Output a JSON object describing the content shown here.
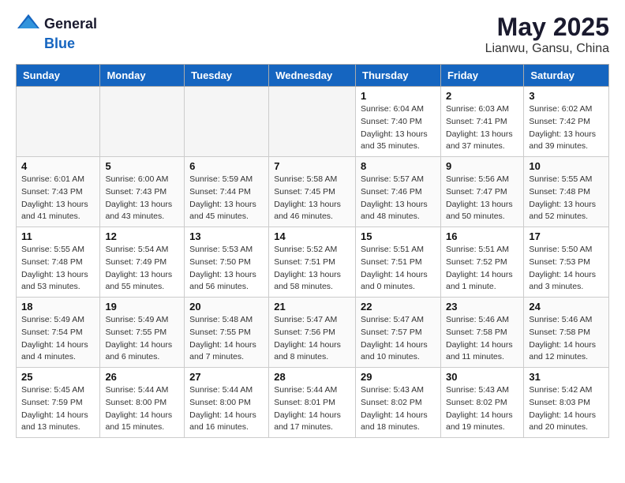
{
  "header": {
    "logo_general": "General",
    "logo_blue": "Blue",
    "title": "May 2025",
    "subtitle": "Lianwu, Gansu, China"
  },
  "days_of_week": [
    "Sunday",
    "Monday",
    "Tuesday",
    "Wednesday",
    "Thursday",
    "Friday",
    "Saturday"
  ],
  "weeks": [
    [
      {
        "day": "",
        "empty": true
      },
      {
        "day": "",
        "empty": true
      },
      {
        "day": "",
        "empty": true
      },
      {
        "day": "",
        "empty": true
      },
      {
        "day": "1",
        "sunrise": "Sunrise: 6:04 AM",
        "sunset": "Sunset: 7:40 PM",
        "daylight": "Daylight: 13 hours and 35 minutes."
      },
      {
        "day": "2",
        "sunrise": "Sunrise: 6:03 AM",
        "sunset": "Sunset: 7:41 PM",
        "daylight": "Daylight: 13 hours and 37 minutes."
      },
      {
        "day": "3",
        "sunrise": "Sunrise: 6:02 AM",
        "sunset": "Sunset: 7:42 PM",
        "daylight": "Daylight: 13 hours and 39 minutes."
      }
    ],
    [
      {
        "day": "4",
        "sunrise": "Sunrise: 6:01 AM",
        "sunset": "Sunset: 7:43 PM",
        "daylight": "Daylight: 13 hours and 41 minutes."
      },
      {
        "day": "5",
        "sunrise": "Sunrise: 6:00 AM",
        "sunset": "Sunset: 7:43 PM",
        "daylight": "Daylight: 13 hours and 43 minutes."
      },
      {
        "day": "6",
        "sunrise": "Sunrise: 5:59 AM",
        "sunset": "Sunset: 7:44 PM",
        "daylight": "Daylight: 13 hours and 45 minutes."
      },
      {
        "day": "7",
        "sunrise": "Sunrise: 5:58 AM",
        "sunset": "Sunset: 7:45 PM",
        "daylight": "Daylight: 13 hours and 46 minutes."
      },
      {
        "day": "8",
        "sunrise": "Sunrise: 5:57 AM",
        "sunset": "Sunset: 7:46 PM",
        "daylight": "Daylight: 13 hours and 48 minutes."
      },
      {
        "day": "9",
        "sunrise": "Sunrise: 5:56 AM",
        "sunset": "Sunset: 7:47 PM",
        "daylight": "Daylight: 13 hours and 50 minutes."
      },
      {
        "day": "10",
        "sunrise": "Sunrise: 5:55 AM",
        "sunset": "Sunset: 7:48 PM",
        "daylight": "Daylight: 13 hours and 52 minutes."
      }
    ],
    [
      {
        "day": "11",
        "sunrise": "Sunrise: 5:55 AM",
        "sunset": "Sunset: 7:48 PM",
        "daylight": "Daylight: 13 hours and 53 minutes."
      },
      {
        "day": "12",
        "sunrise": "Sunrise: 5:54 AM",
        "sunset": "Sunset: 7:49 PM",
        "daylight": "Daylight: 13 hours and 55 minutes."
      },
      {
        "day": "13",
        "sunrise": "Sunrise: 5:53 AM",
        "sunset": "Sunset: 7:50 PM",
        "daylight": "Daylight: 13 hours and 56 minutes."
      },
      {
        "day": "14",
        "sunrise": "Sunrise: 5:52 AM",
        "sunset": "Sunset: 7:51 PM",
        "daylight": "Daylight: 13 hours and 58 minutes."
      },
      {
        "day": "15",
        "sunrise": "Sunrise: 5:51 AM",
        "sunset": "Sunset: 7:51 PM",
        "daylight": "Daylight: 14 hours and 0 minutes."
      },
      {
        "day": "16",
        "sunrise": "Sunrise: 5:51 AM",
        "sunset": "Sunset: 7:52 PM",
        "daylight": "Daylight: 14 hours and 1 minute."
      },
      {
        "day": "17",
        "sunrise": "Sunrise: 5:50 AM",
        "sunset": "Sunset: 7:53 PM",
        "daylight": "Daylight: 14 hours and 3 minutes."
      }
    ],
    [
      {
        "day": "18",
        "sunrise": "Sunrise: 5:49 AM",
        "sunset": "Sunset: 7:54 PM",
        "daylight": "Daylight: 14 hours and 4 minutes."
      },
      {
        "day": "19",
        "sunrise": "Sunrise: 5:49 AM",
        "sunset": "Sunset: 7:55 PM",
        "daylight": "Daylight: 14 hours and 6 minutes."
      },
      {
        "day": "20",
        "sunrise": "Sunrise: 5:48 AM",
        "sunset": "Sunset: 7:55 PM",
        "daylight": "Daylight: 14 hours and 7 minutes."
      },
      {
        "day": "21",
        "sunrise": "Sunrise: 5:47 AM",
        "sunset": "Sunset: 7:56 PM",
        "daylight": "Daylight: 14 hours and 8 minutes."
      },
      {
        "day": "22",
        "sunrise": "Sunrise: 5:47 AM",
        "sunset": "Sunset: 7:57 PM",
        "daylight": "Daylight: 14 hours and 10 minutes."
      },
      {
        "day": "23",
        "sunrise": "Sunrise: 5:46 AM",
        "sunset": "Sunset: 7:58 PM",
        "daylight": "Daylight: 14 hours and 11 minutes."
      },
      {
        "day": "24",
        "sunrise": "Sunrise: 5:46 AM",
        "sunset": "Sunset: 7:58 PM",
        "daylight": "Daylight: 14 hours and 12 minutes."
      }
    ],
    [
      {
        "day": "25",
        "sunrise": "Sunrise: 5:45 AM",
        "sunset": "Sunset: 7:59 PM",
        "daylight": "Daylight: 14 hours and 13 minutes."
      },
      {
        "day": "26",
        "sunrise": "Sunrise: 5:44 AM",
        "sunset": "Sunset: 8:00 PM",
        "daylight": "Daylight: 14 hours and 15 minutes."
      },
      {
        "day": "27",
        "sunrise": "Sunrise: 5:44 AM",
        "sunset": "Sunset: 8:00 PM",
        "daylight": "Daylight: 14 hours and 16 minutes."
      },
      {
        "day": "28",
        "sunrise": "Sunrise: 5:44 AM",
        "sunset": "Sunset: 8:01 PM",
        "daylight": "Daylight: 14 hours and 17 minutes."
      },
      {
        "day": "29",
        "sunrise": "Sunrise: 5:43 AM",
        "sunset": "Sunset: 8:02 PM",
        "daylight": "Daylight: 14 hours and 18 minutes."
      },
      {
        "day": "30",
        "sunrise": "Sunrise: 5:43 AM",
        "sunset": "Sunset: 8:02 PM",
        "daylight": "Daylight: 14 hours and 19 minutes."
      },
      {
        "day": "31",
        "sunrise": "Sunrise: 5:42 AM",
        "sunset": "Sunset: 8:03 PM",
        "daylight": "Daylight: 14 hours and 20 minutes."
      }
    ]
  ]
}
